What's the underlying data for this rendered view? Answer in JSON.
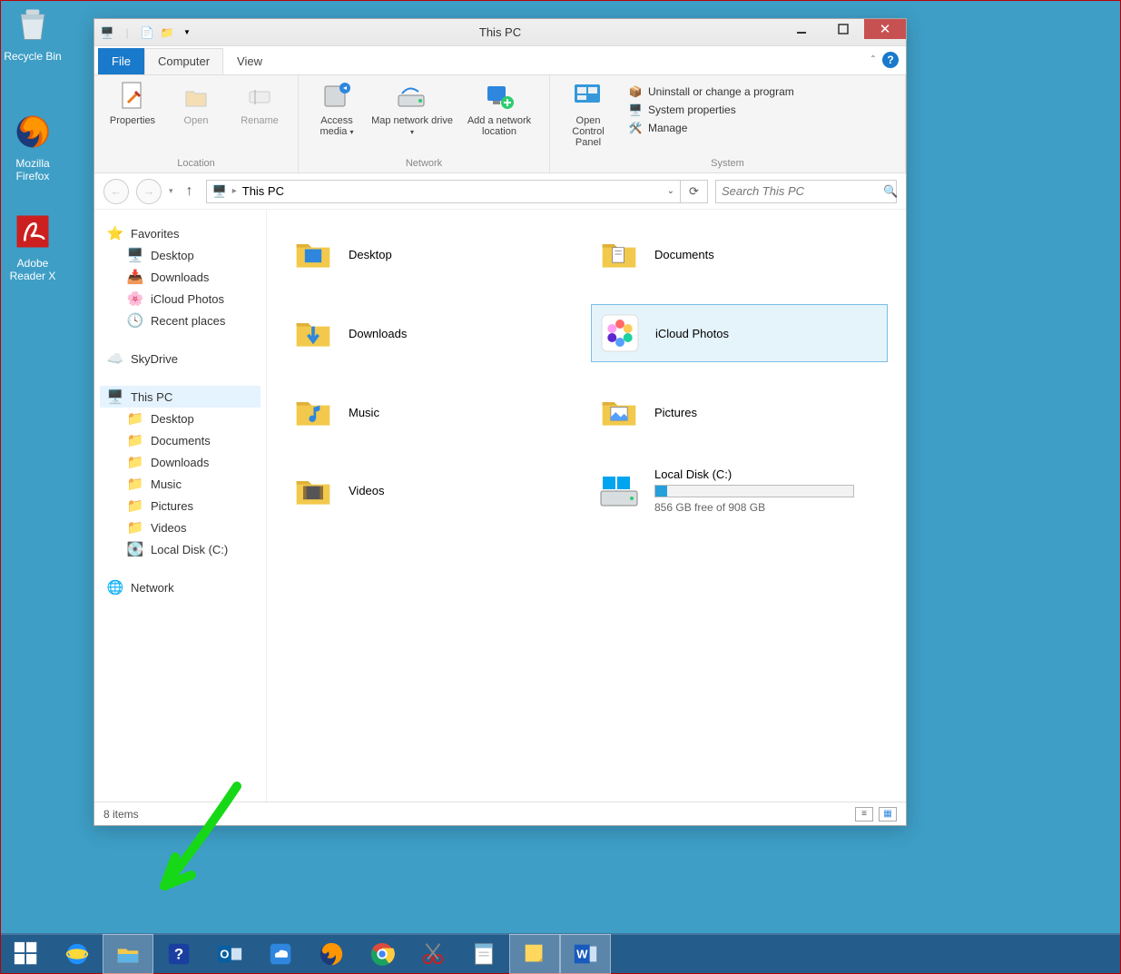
{
  "desktop": {
    "icons": [
      {
        "label": "Recycle Bin"
      },
      {
        "label": "Mozilla Firefox"
      },
      {
        "label": "Adobe Reader X"
      }
    ]
  },
  "window": {
    "title": "This PC",
    "tabs": {
      "file": "File",
      "computer": "Computer",
      "view": "View"
    },
    "ribbon": {
      "location": {
        "properties": "Properties",
        "open": "Open",
        "rename": "Rename",
        "label": "Location"
      },
      "network": {
        "access": "Access media",
        "map": "Map network drive",
        "add": "Add a network location",
        "label": "Network"
      },
      "system": {
        "ocp": "Open Control Panel",
        "uninstall": "Uninstall or change a program",
        "sysprops": "System properties",
        "manage": "Manage",
        "label": "System"
      }
    },
    "address": {
      "crumb": "This PC"
    },
    "search": {
      "placeholder": "Search This PC"
    },
    "nav": {
      "favorites": "Favorites",
      "fav_items": [
        "Desktop",
        "Downloads",
        "iCloud Photos",
        "Recent places"
      ],
      "skydrive": "SkyDrive",
      "thispc": "This PC",
      "pc_items": [
        "Desktop",
        "Documents",
        "Downloads",
        "Music",
        "Pictures",
        "Videos",
        "Local Disk (C:)"
      ],
      "network": "Network"
    },
    "tiles": {
      "desktop": "Desktop",
      "documents": "Documents",
      "downloads": "Downloads",
      "icloud": "iCloud Photos",
      "music": "Music",
      "pictures": "Pictures",
      "videos": "Videos",
      "localdisk": {
        "name": "Local Disk (C:)",
        "free": "856 GB free of 908 GB",
        "fill_pct": 6
      }
    },
    "status": "8 items"
  }
}
